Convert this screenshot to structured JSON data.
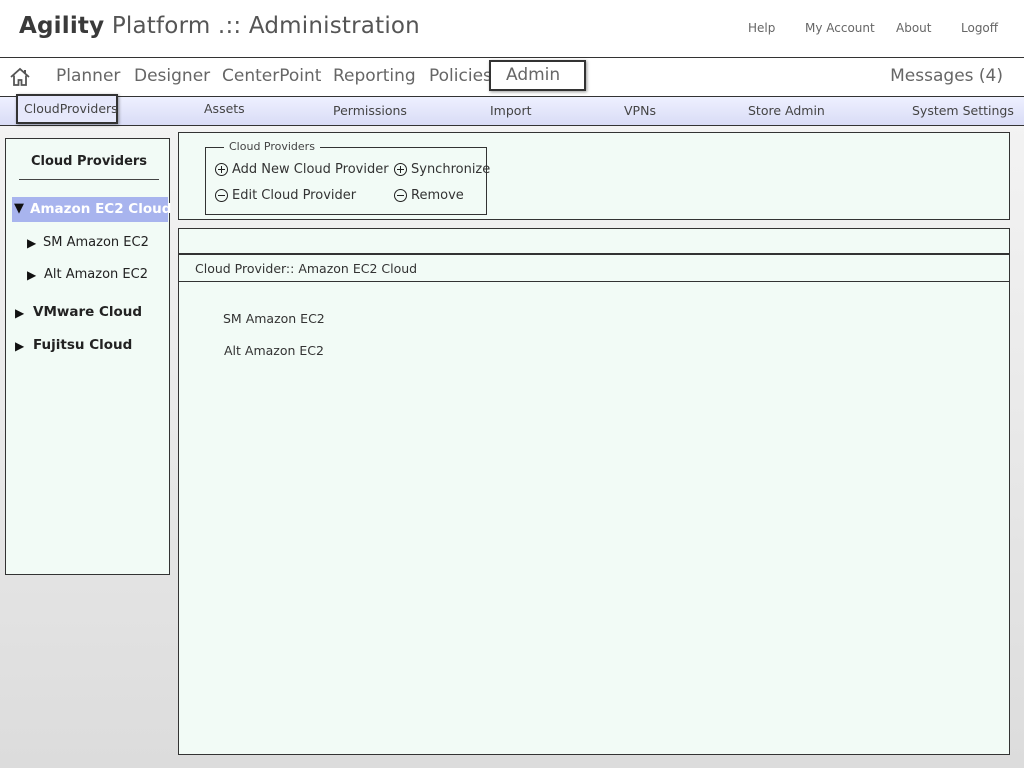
{
  "header": {
    "brand_name": "Agility",
    "brand_rest": "Platform .:: Administration",
    "links": [
      "Help",
      "My Account",
      "About",
      "Logoff"
    ]
  },
  "main_nav": {
    "home_icon": "home-icon",
    "items": [
      "Planner",
      "Designer",
      "CenterPoint",
      "Reporting",
      "Policies",
      "Admin"
    ],
    "active": "Admin",
    "messages": "Messages (4)"
  },
  "sub_nav": {
    "items": [
      "CloudProviders",
      "Assets",
      "Permissions",
      "Import",
      "VPNs",
      "Store Admin",
      "System Settings"
    ],
    "active": "CloudProviders",
    "background": "#dcdff7"
  },
  "tree": {
    "title": "Cloud Providers",
    "selected_color": "#a8b4ee",
    "nodes": [
      {
        "label": "Amazon EC2 Cloud",
        "expanded": true,
        "selected": true,
        "children": [
          "SM Amazon EC2",
          "Alt Amazon EC2"
        ]
      },
      {
        "label": "VMware Cloud",
        "expanded": false
      },
      {
        "label": "Fujitsu Cloud",
        "expanded": false
      }
    ]
  },
  "actions": {
    "legend": "Cloud Providers",
    "add": "Add New Cloud Provider",
    "edit": "Edit Cloud Provider",
    "sync": "Synchronize",
    "remove": "Remove"
  },
  "content": {
    "title": "Cloud Provider:: Amazon EC2 Cloud",
    "items": [
      "SM Amazon EC2",
      "Alt Amazon EC2"
    ],
    "panel_color": "#f2fbf6"
  }
}
